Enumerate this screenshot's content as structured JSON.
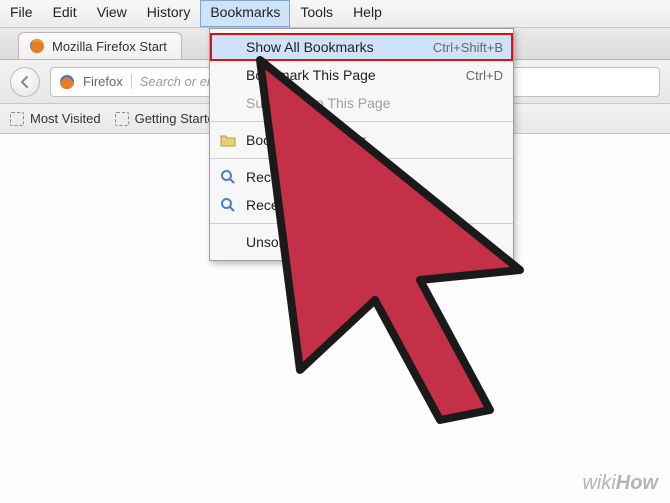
{
  "menubar": {
    "items": [
      "File",
      "Edit",
      "View",
      "History",
      "Bookmarks",
      "Tools",
      "Help"
    ],
    "active_index": 4
  },
  "tab": {
    "title": "Mozilla Firefox Start"
  },
  "nav": {
    "identity": "Firefox",
    "placeholder": "Search or enter address"
  },
  "bookmarks_toolbar": {
    "items": [
      {
        "label": "Most Visited"
      },
      {
        "label": "Getting Started"
      }
    ]
  },
  "dropdown": {
    "items": [
      {
        "label": "Show All Bookmarks",
        "shortcut": "Ctrl+Shift+B",
        "highlight": true
      },
      {
        "label": "Bookmark This Page",
        "shortcut": "Ctrl+D"
      },
      {
        "label": "Subscribe to This Page",
        "disabled": true
      },
      {
        "sep": true
      },
      {
        "label": "Bookmarks Toolbar",
        "icon": "folder"
      },
      {
        "sep": true
      },
      {
        "label": "Recently Bookmarked",
        "icon": "search"
      },
      {
        "label": "Recent Tags",
        "icon": "search"
      },
      {
        "sep": true
      },
      {
        "label": "Unsorted Bookmarks"
      }
    ]
  },
  "watermark": {
    "a": "wiki",
    "b": "How"
  }
}
